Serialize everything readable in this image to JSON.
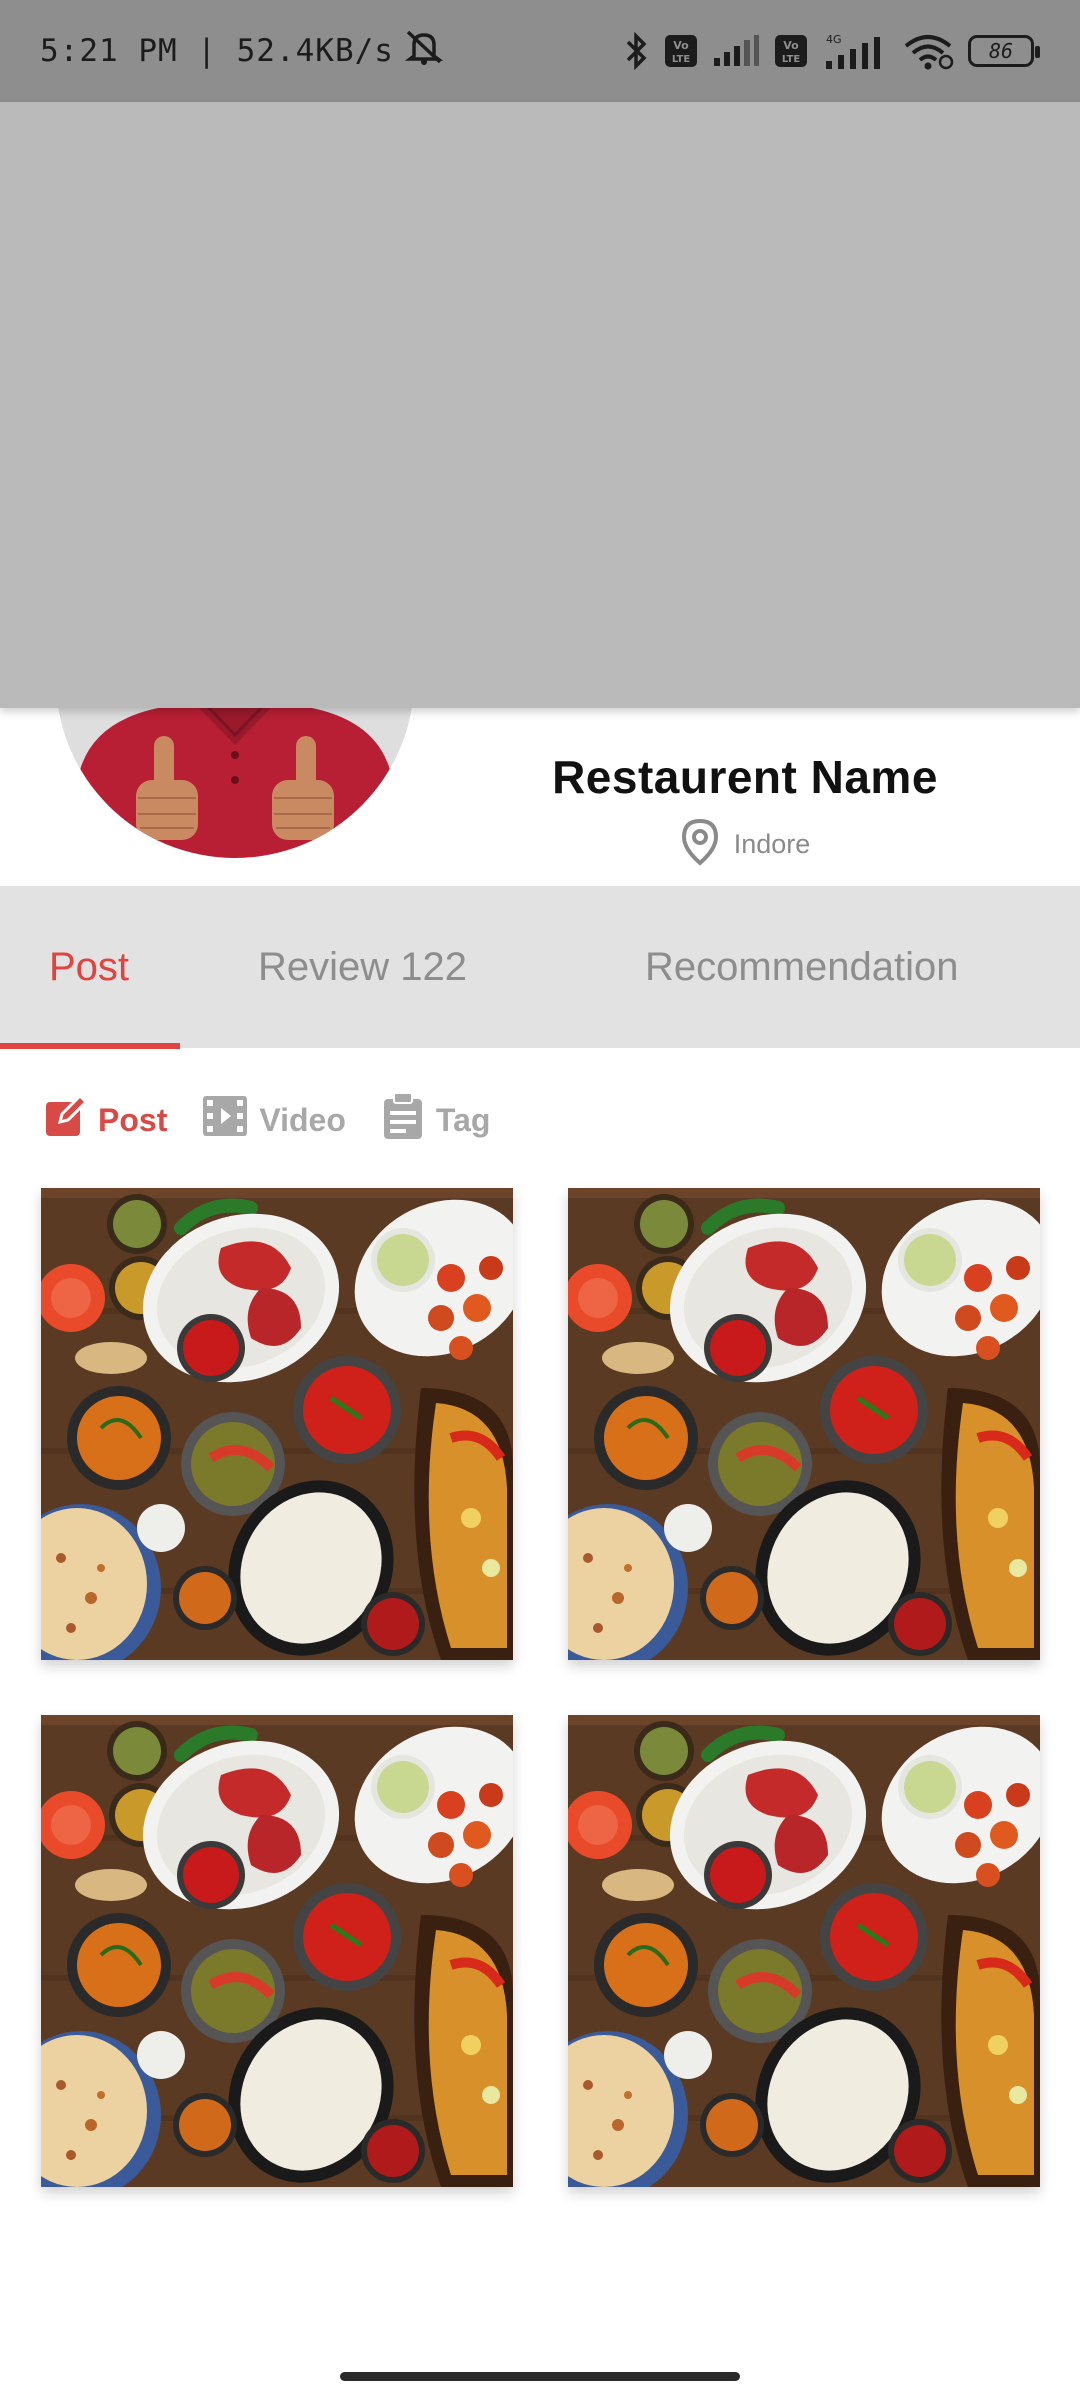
{
  "status_bar": {
    "time_speed": "5:21 PM | 52.4KB/s",
    "battery": "86",
    "icons": [
      "mute-icon",
      "bluetooth-icon",
      "volte-icon",
      "signal-icon",
      "volte-icon",
      "signal-4g-icon",
      "wifi-icon",
      "battery-icon"
    ]
  },
  "profile": {
    "name": "Restaurent Name",
    "location": "Indore"
  },
  "tabs": [
    {
      "label": "Post",
      "active": true
    },
    {
      "label": "Review 122",
      "active": false
    },
    {
      "label": "Recommendation",
      "active": false
    }
  ],
  "filters": [
    {
      "label": "Post",
      "icon": "edit-icon",
      "active": true
    },
    {
      "label": "Video",
      "icon": "film-icon",
      "active": false
    },
    {
      "label": "Tag",
      "icon": "note-icon",
      "active": false
    }
  ],
  "colors": {
    "accent": "#e0443f",
    "tab_bg": "#e2e2e2",
    "cover": "#bababa",
    "status_bar": "#8e8e8e"
  }
}
